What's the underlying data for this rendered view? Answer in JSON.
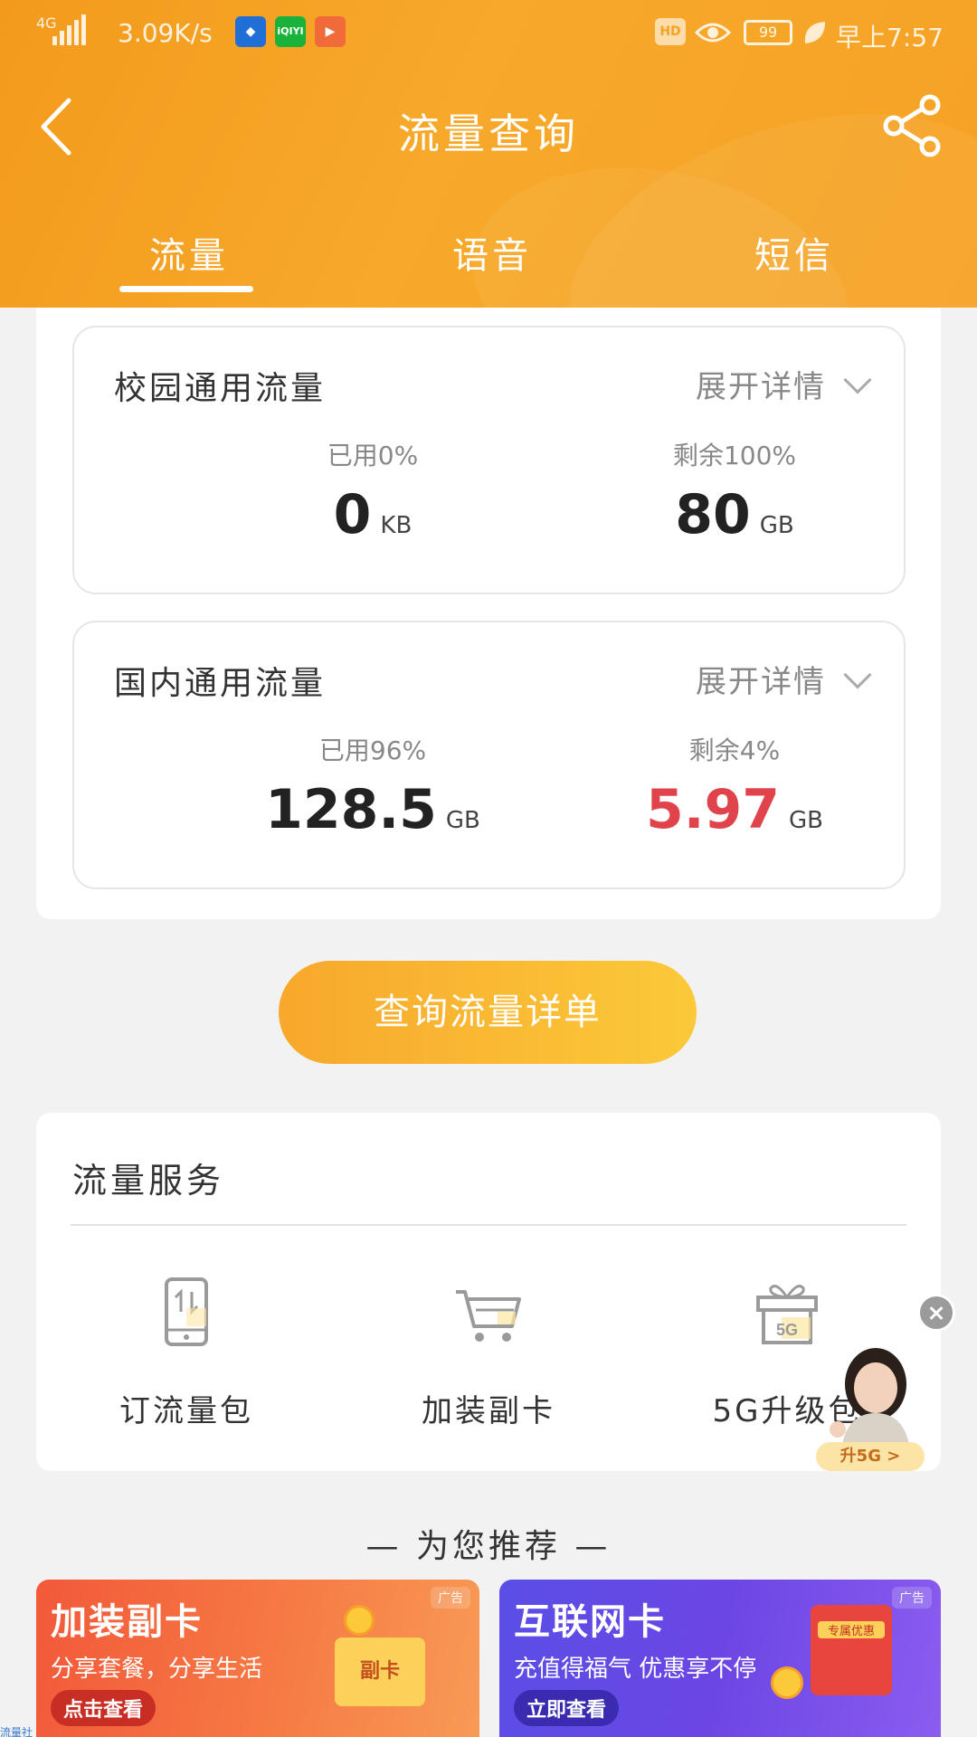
{
  "status_bar": {
    "network": "4G",
    "speed": "3.09K/s",
    "battery": "99",
    "time": "早上7:57",
    "hd": "HD"
  },
  "header": {
    "title": "流量查询",
    "tabs": [
      "流量",
      "语音",
      "短信"
    ],
    "active_tab": "流量"
  },
  "usage_cards": [
    {
      "title": "校园通用流量",
      "expand_label": "展开详情",
      "used_label": "已用0%",
      "used_value": "0",
      "used_unit": "KB",
      "remaining_label": "剩余100%",
      "remaining_value": "80",
      "remaining_unit": "GB"
    },
    {
      "title": "国内通用流量",
      "expand_label": "展开详情",
      "used_label": "已用96%",
      "used_value": "128.5",
      "used_unit": "GB",
      "remaining_label": "剩余4%",
      "remaining_value": "5.97",
      "remaining_unit": "GB"
    }
  ],
  "query_button": "查询流量详单",
  "services": {
    "title": "流量服务",
    "items": [
      {
        "label": "订流量包",
        "icon": "phone-data-icon"
      },
      {
        "label": "加装副卡",
        "icon": "cart-icon"
      },
      {
        "label": "5G升级包",
        "icon": "gift-5g-icon"
      }
    ],
    "promo_pill": "升5G >"
  },
  "recommend_title": "— 为您推荐 —",
  "ads": [
    {
      "tag": "广告",
      "title": "加装副卡",
      "sub": "分享套餐，分享生活",
      "button": "点击查看",
      "card_text": "副卡"
    },
    {
      "tag": "广告",
      "title": "互联网卡",
      "sub": "充值得福气 优惠享不停",
      "button": "立即查看",
      "card_text": "专属优惠"
    }
  ],
  "footer_text": "流量社",
  "colors": {
    "header_orange": "#f6a224",
    "accent_red": "#e0434c",
    "button_gradient_start": "#f8a82c",
    "button_gradient_end": "#fbc93a"
  }
}
